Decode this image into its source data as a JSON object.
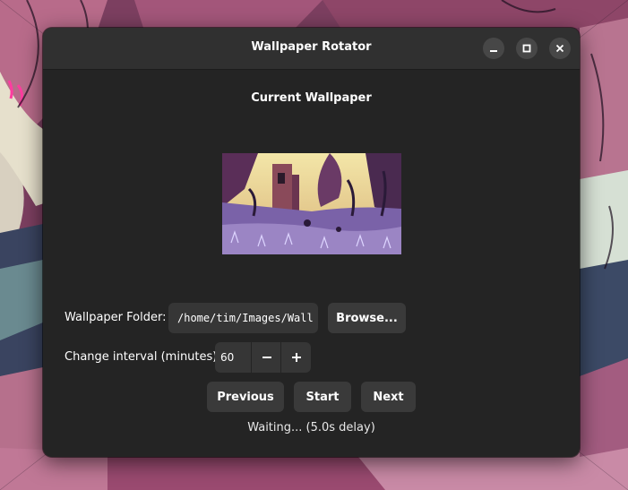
{
  "window": {
    "title": "Wallpaper Rotator"
  },
  "current": {
    "heading": "Current Wallpaper"
  },
  "folder": {
    "label": "Wallpaper Folder:",
    "value": "/home/tim/Images/Wall",
    "browse_label": "Browse..."
  },
  "interval": {
    "label": "Change interval (minutes):",
    "value": "60"
  },
  "controls": {
    "previous_label": "Previous",
    "start_label": "Start",
    "next_label": "Next"
  },
  "status": {
    "text": "Waiting... (5.0s delay)"
  },
  "icons": {
    "minimize": "minimize-icon",
    "maximize": "maximize-icon",
    "close": "close-icon",
    "decrement": "minus-icon",
    "increment": "plus-icon"
  },
  "colors": {
    "window_bg": "#242424",
    "titlebar_bg": "#303030",
    "button_bg": "#3a3a3a",
    "entry_bg": "#363636",
    "text": "#ffffff"
  }
}
